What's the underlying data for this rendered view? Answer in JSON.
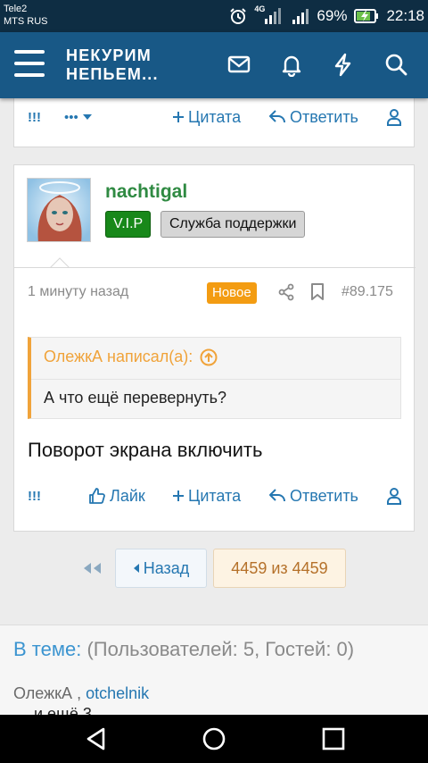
{
  "status_bar": {
    "carrier_1": "Tele2",
    "carrier_2": "MTS RUS",
    "network": "4G",
    "battery": "69%",
    "time": "22:18"
  },
  "header": {
    "logo_line1": "НЕКУРИМ",
    "logo_line2": "НЕПЬЕМ...",
    "icons": [
      "mail-icon",
      "bell-icon",
      "lightning-icon",
      "search-icon"
    ]
  },
  "prev_post": {
    "report": "!!!",
    "more": "•••",
    "quote": "Цитата",
    "reply": "Ответить"
  },
  "post": {
    "username": "nachtigal",
    "badge_vip": "V.I.P",
    "badge_role": "Служба поддержки",
    "time_ago": "1 минуту назад",
    "new_label": "Новое",
    "post_number": "#89.175",
    "quote_author": "ОлежкА написал(а):",
    "quote_text": "А что ещё перевернуть?",
    "message": "Поворот экрана включить",
    "action_report": "!!!",
    "action_like": "Лайк",
    "action_quote": "Цитата",
    "action_reply": "Ответить"
  },
  "pagination": {
    "back_label": "Назад",
    "page_info": "4459 из 4459"
  },
  "in_topic": {
    "label": "В теме:",
    "stats": "(Пользователей: 5, Гостей: 0)",
    "user1": "ОлежкА",
    "separator": ",",
    "user2": "otchelnik",
    "cut_text": "… и ещё 3"
  },
  "colors": {
    "header_bg": "#185886",
    "status_bg": "#0e2d43",
    "link": "#2577b1",
    "username": "#2f8a42",
    "vip_badge": "#18881a",
    "new_badge": "#f39c12",
    "quote_accent": "#f0a33a"
  }
}
